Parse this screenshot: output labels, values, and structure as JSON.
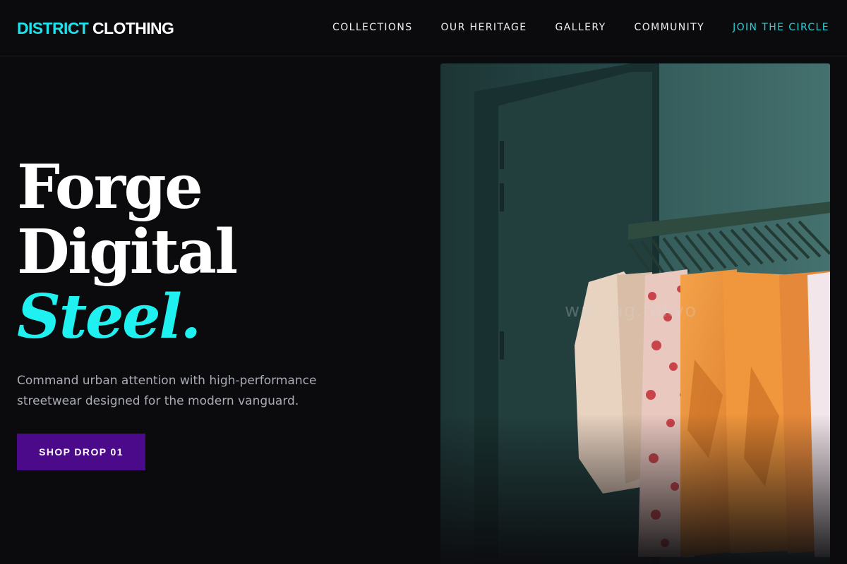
{
  "header": {
    "logo_part1": "DISTRICT",
    "logo_part2": "CLOTHING",
    "nav": [
      {
        "label": "COLLECTIONS"
      },
      {
        "label": "OUR HERITAGE"
      },
      {
        "label": "GALLERY"
      },
      {
        "label": "COMMUNITY"
      },
      {
        "label": "JOIN THE CIRCLE"
      }
    ]
  },
  "hero": {
    "headline_line1": "Forge",
    "headline_line2": "Digital",
    "headline_line3": "Steel.",
    "subtitle": "Command urban attention with high-performance streetwear designed for the modern vanguard.",
    "cta_label": "SHOP DROP 01",
    "image_watermark": "wa...ag.tokyo",
    "image_icon": "clothing-rack-photo"
  },
  "colors": {
    "background": "#0b0b0e",
    "accent_cyan": "#1fe3ec",
    "cta_purple": "#4b0a8a",
    "text_muted": "#a9acb4"
  }
}
